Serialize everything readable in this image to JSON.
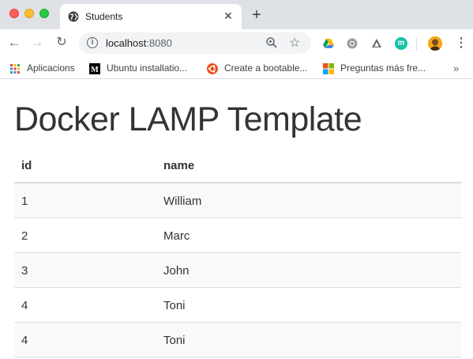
{
  "browser": {
    "tab_title": "Students",
    "tab_close": "✕",
    "new_tab": "+",
    "url_host": "localhost",
    "url_port": ":8080",
    "bookmarks": [
      {
        "label": "Aplicacions"
      },
      {
        "label": "Ubuntu installatio..."
      },
      {
        "label": "Create a bootable..."
      },
      {
        "label": "Preguntas más fre..."
      }
    ],
    "bookmarks_more": "»",
    "extension_m_letter": "m"
  },
  "page": {
    "title": "Docker LAMP Template",
    "table": {
      "headers": [
        "id",
        "name"
      ],
      "rows": [
        [
          "1",
          "William"
        ],
        [
          "2",
          "Marc"
        ],
        [
          "3",
          "John"
        ],
        [
          "4",
          "Toni"
        ],
        [
          "4",
          "Toni"
        ]
      ]
    }
  },
  "colors": {
    "tabstrip_bg": "#dee1e6",
    "omnibox_bg": "#f1f3f4",
    "text": "#333333",
    "row_stripe": "#f9f9f9"
  }
}
